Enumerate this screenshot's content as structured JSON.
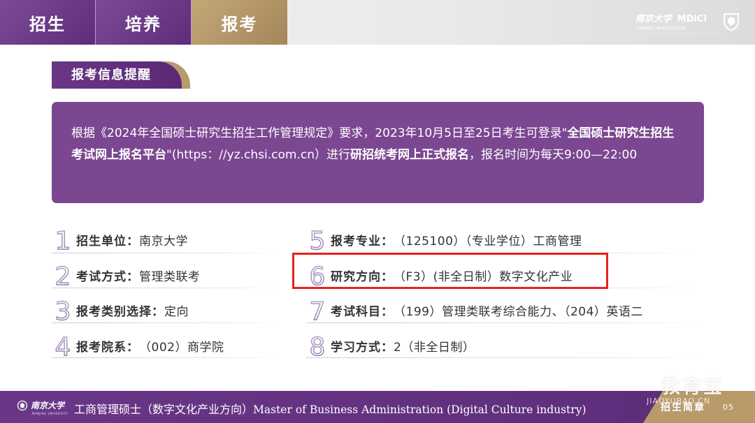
{
  "nav": {
    "tabs": [
      {
        "label": "招生"
      },
      {
        "label": "培养"
      },
      {
        "label": "报考",
        "active": true
      }
    ]
  },
  "brand": {
    "script": "南京大学",
    "name": "MDiCI",
    "subtitle": "工商管理硕士(数字文化产业方向)",
    "subtitle_en": "Master of Business Administration (Digital Culture Industry)"
  },
  "section": {
    "title": "报考信息提醒"
  },
  "notice": {
    "t1": "根据《2024年全国硕士研究生招生工作管理规定》要求，2023年10月5日至25日考生可登录\"",
    "b1": "全国硕士研究生招生考试网上报名平台",
    "t2": "\"(https：//yz.chsi.com.cn）进行",
    "b2": "研招统考网上正式报名",
    "t3": "，报名时间为每天9:00—22:00"
  },
  "items": [
    {
      "num": "1",
      "label": "招生单位：",
      "value": "南京大学"
    },
    {
      "num": "2",
      "label": "考试方式：",
      "value": "管理类联考"
    },
    {
      "num": "3",
      "label": "报考类别选择：",
      "value": "定向"
    },
    {
      "num": "4",
      "label": "报考院系：",
      "value": "（002）商学院"
    },
    {
      "num": "5",
      "label": "报考专业：",
      "value": "（125100）（专业学位）工商管理"
    },
    {
      "num": "6",
      "label": "研究方向：",
      "value": "（F3）(非全日制）数字文化产业"
    },
    {
      "num": "7",
      "label": "考试科目：",
      "value": "（199）管理类联考综合能力、（204）英语二"
    },
    {
      "num": "8",
      "label": "学习方式：",
      "value": "2（非全日制）"
    }
  ],
  "footer": {
    "logo_script": "南京大学",
    "logo_sub": "NANJING UNIVERSITY",
    "title_cn": "工商管理硕士（数字文化产业方向）",
    "title_en": "Master of Business Administration (Digital Culture industry)",
    "right_label": "招生简章",
    "page": "05"
  },
  "watermark": {
    "text": "教育宝",
    "sub": "JIAOYUBAO.CN"
  },
  "colors": {
    "purple": "#6a3687",
    "gold": "#b89a6b",
    "highlight_red": "#e8211a"
  }
}
